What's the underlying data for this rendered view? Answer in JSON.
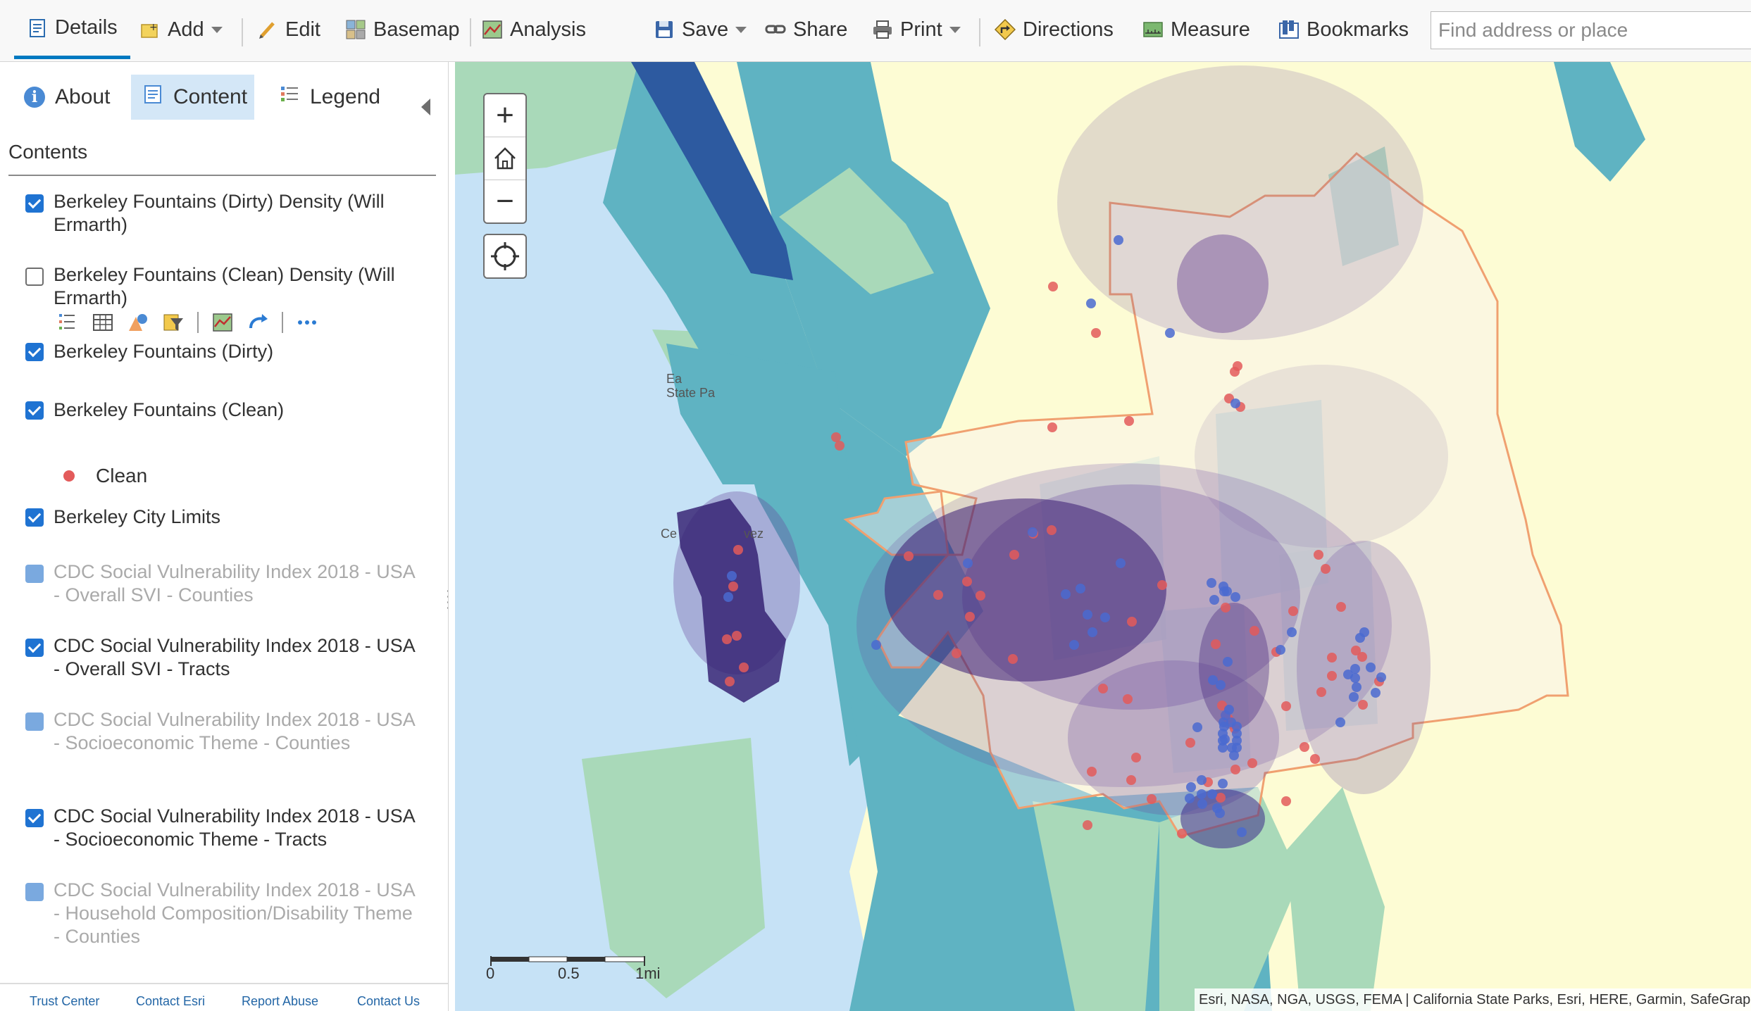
{
  "toolbar": {
    "details": "Details",
    "add": "Add",
    "edit": "Edit",
    "basemap": "Basemap",
    "analysis": "Analysis",
    "save": "Save",
    "share": "Share",
    "print": "Print",
    "directions": "Directions",
    "measure": "Measure",
    "bookmarks": "Bookmarks",
    "search_placeholder": "Find address or place"
  },
  "panel": {
    "tabs": {
      "about": "About",
      "content": "Content",
      "legend": "Legend"
    },
    "active_tab": "Content",
    "contents_title": "Contents",
    "layers": [
      {
        "name": "Berkeley Fountains (Dirty) Density (Will Ermarth)",
        "checked": true,
        "dimmed": false
      },
      {
        "name": "Berkeley Fountains (Clean) Density (Will Ermarth)",
        "checked": false,
        "dimmed": false
      },
      {
        "name": "Berkeley Fountains (Dirty)",
        "checked": true,
        "dimmed": false
      },
      {
        "name": "Berkeley Fountains (Clean)",
        "checked": true,
        "dimmed": false
      },
      {
        "name": "Berkeley City Limits",
        "checked": true,
        "dimmed": false
      },
      {
        "name": "CDC Social Vulnerability Index 2018 - USA - Overall SVI - Counties",
        "checked": true,
        "dimmed": true
      },
      {
        "name": "CDC Social Vulnerability Index 2018 - USA - Overall SVI - Tracts",
        "checked": true,
        "dimmed": false
      },
      {
        "name": "CDC Social Vulnerability Index 2018 - USA - Socioeconomic Theme - Counties",
        "checked": true,
        "dimmed": true
      },
      {
        "name": "CDC Social Vulnerability Index 2018 - USA - Socioeconomic Theme - Tracts",
        "checked": true,
        "dimmed": false
      },
      {
        "name": "CDC Social Vulnerability Index 2018 - USA - Household Composition/Disability Theme - Counties",
        "checked": true,
        "dimmed": true
      }
    ],
    "legend_item": {
      "label": "Clean",
      "color": "#e35b5b"
    },
    "tools": [
      "show-legend-icon",
      "table-icon",
      "change-style-icon",
      "filter-icon",
      "analysis-icon",
      "refresh-icon",
      "more-options-icon"
    ],
    "footer_links": [
      "Trust Center",
      "Contact Esri",
      "Report Abuse",
      "Contact Us"
    ]
  },
  "map": {
    "zoom_in": "+",
    "zoom_out": "−",
    "scale": {
      "labels": [
        "0",
        "0.5",
        "1mi"
      ]
    },
    "attribution": "Esri, NASA, NGA, USGS, FEMA | California State Parks, Esri, HERE, Garmin, SafeGraph, G",
    "place_labels": [
      "Ea",
      "State Pa",
      "Ce",
      "vez"
    ],
    "colors": {
      "water": "#c4e1f5",
      "tract_dark": "#2d5aa0",
      "tract_teal": "#5fb3c3",
      "tract_light": "#a8d8b8",
      "yellow": "#fdfcd2",
      "city_limit": "#f0a070",
      "density": "#3b1c72"
    }
  }
}
